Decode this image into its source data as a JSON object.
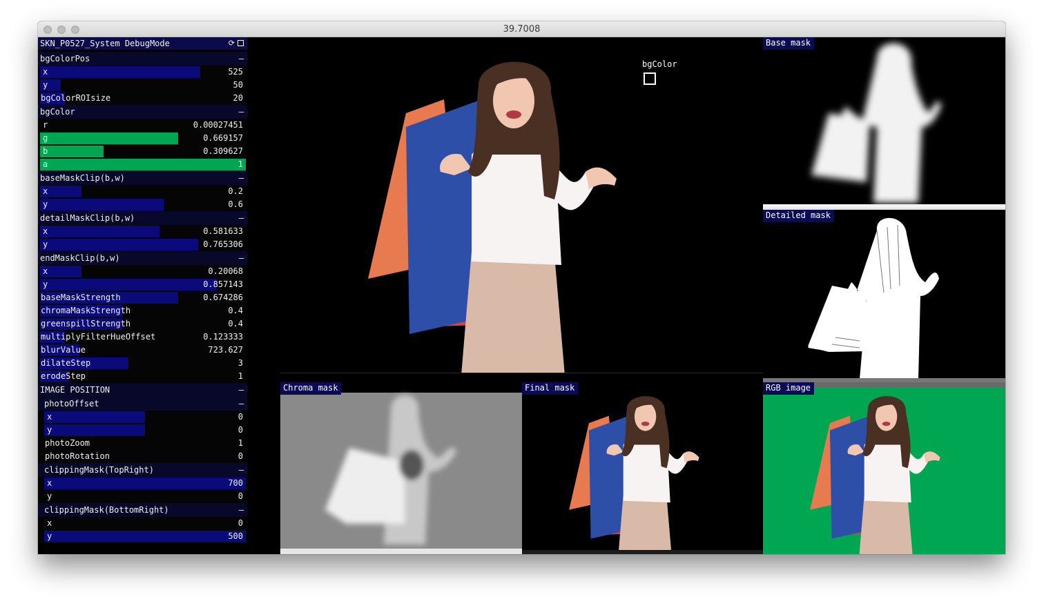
{
  "window": {
    "title": "39.7008"
  },
  "panel": {
    "title": "SKN_P0527_System DebugMode",
    "rows": [
      {
        "type": "header",
        "label": "bgColorPos",
        "toggle": "–"
      },
      {
        "type": "slider",
        "label": "x",
        "value": "525",
        "level": 0.78,
        "color": "#0a0a7a",
        "indent": 0
      },
      {
        "type": "slider",
        "label": "y",
        "value": "50",
        "level": 0.1,
        "color": "#0a0a7a",
        "indent": 0
      },
      {
        "type": "slider",
        "label": "bgColorROIsize",
        "value": "20",
        "level": 0.12,
        "color": "#0a0a7a",
        "indent": 0
      },
      {
        "type": "header",
        "label": "bgColor",
        "toggle": "–"
      },
      {
        "type": "slider",
        "label": "r",
        "value": "0.00027451",
        "level": 0.0,
        "color": "#00a651",
        "indent": 0
      },
      {
        "type": "slider",
        "label": "g",
        "value": "0.669157",
        "level": 0.67,
        "color": "#00a651",
        "indent": 0
      },
      {
        "type": "slider",
        "label": "b",
        "value": "0.309627",
        "level": 0.31,
        "color": "#00a651",
        "indent": 0
      },
      {
        "type": "slider",
        "label": "a",
        "value": "1",
        "level": 1.0,
        "color": "#00a651",
        "indent": 0
      },
      {
        "type": "header",
        "label": "baseMaskClip(b,w)",
        "toggle": "–"
      },
      {
        "type": "slider",
        "label": "x",
        "value": "0.2",
        "level": 0.2,
        "color": "#0a0a7a",
        "indent": 0
      },
      {
        "type": "slider",
        "label": "y",
        "value": "0.6",
        "level": 0.6,
        "color": "#0a0a7a",
        "indent": 0
      },
      {
        "type": "header",
        "label": "detailMaskClip(b,w)",
        "toggle": "–"
      },
      {
        "type": "slider",
        "label": "x",
        "value": "0.581633",
        "level": 0.58,
        "color": "#0a0a7a",
        "indent": 0
      },
      {
        "type": "slider",
        "label": "y",
        "value": "0.765306",
        "level": 0.77,
        "color": "#0a0a7a",
        "indent": 0
      },
      {
        "type": "header",
        "label": "endMaskClip(b,w)",
        "toggle": "–"
      },
      {
        "type": "slider",
        "label": "x",
        "value": "0.20068",
        "level": 0.2,
        "color": "#0a0a7a",
        "indent": 0
      },
      {
        "type": "slider",
        "label": "y",
        "value": "0.857143",
        "level": 0.86,
        "color": "#0a0a7a",
        "indent": 0
      },
      {
        "type": "slider",
        "label": "baseMaskStrength",
        "value": "0.674286",
        "level": 0.67,
        "color": "#0a0a7a",
        "indent": 0
      },
      {
        "type": "slider",
        "label": "chromaMaskStrength",
        "value": "0.4",
        "level": 0.4,
        "color": "#0a0a7a",
        "indent": 0
      },
      {
        "type": "slider",
        "label": "greenspillStrength",
        "value": "0.4",
        "level": 0.4,
        "color": "#0a0a7a",
        "indent": 0
      },
      {
        "type": "slider",
        "label": "multiplyFilterHueOffset",
        "value": "0.123333",
        "level": 0.12,
        "color": "#0a0a7a",
        "indent": 0
      },
      {
        "type": "slider",
        "label": "blurValue",
        "value": "723.627",
        "level": 0.19,
        "color": "#0a0a7a",
        "indent": 0
      },
      {
        "type": "slider",
        "label": "dilateStep",
        "value": "3",
        "level": 0.43,
        "color": "#0a0a7a",
        "indent": 0
      },
      {
        "type": "slider",
        "label": "erodeStep",
        "value": "1",
        "level": 0.14,
        "color": "#0a0a7a",
        "indent": 0
      },
      {
        "type": "header",
        "label": "IMAGE POSITION",
        "toggle": "–"
      },
      {
        "type": "header",
        "label": "photoOffset",
        "toggle": "–",
        "indent": 6
      },
      {
        "type": "slider",
        "label": "x",
        "value": "0",
        "level": 0.5,
        "color": "#0a0a7a",
        "indent": 6
      },
      {
        "type": "slider",
        "label": "y",
        "value": "0",
        "level": 0.5,
        "color": "#0a0a7a",
        "indent": 6
      },
      {
        "type": "slider",
        "label": "photoZoom",
        "value": "1",
        "level": 0.0,
        "color": "#0a0a7a",
        "indent": 6
      },
      {
        "type": "slider",
        "label": "photoRotation",
        "value": "0",
        "level": 0.0,
        "color": "#0a0a7a",
        "indent": 6
      },
      {
        "type": "header",
        "label": "clippingMask(TopRight)",
        "toggle": "–",
        "indent": 6
      },
      {
        "type": "slider",
        "label": "x",
        "value": "700",
        "level": 1.0,
        "color": "#0a0a7a",
        "indent": 6
      },
      {
        "type": "slider",
        "label": "y",
        "value": "0",
        "level": 0.0,
        "color": "#0a0a7a",
        "indent": 6
      },
      {
        "type": "header",
        "label": "clippingMask(BottomRight)",
        "toggle": "–",
        "indent": 6
      },
      {
        "type": "slider",
        "label": "x",
        "value": "0",
        "level": 0.0,
        "color": "#0a0a7a",
        "indent": 6
      },
      {
        "type": "slider",
        "label": "y",
        "value": "500",
        "level": 1.0,
        "color": "#0a0a7a",
        "indent": 6
      }
    ]
  },
  "views": {
    "bgcolor_marker": "bgColor",
    "base_mask": "Base mask",
    "detailed_mask": "Detailed mask",
    "chroma_mask": "Chroma mask",
    "final_mask": "Final mask",
    "rgb_image": "RGB image"
  },
  "colors": {
    "green_screen": "#00a651",
    "slider_blue": "#0a0a7a",
    "header_bg": "#08082a"
  }
}
